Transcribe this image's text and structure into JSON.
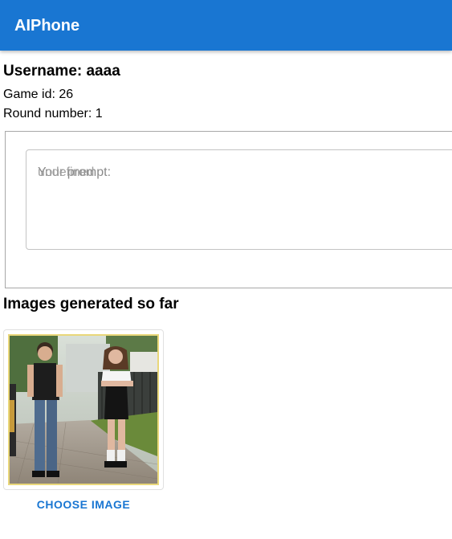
{
  "appbar": {
    "title": "AIPhone"
  },
  "player": {
    "username_line": "Username: aaaa",
    "game_id_line": "Game id: 26",
    "round_line": "Round number: 1"
  },
  "prompt": {
    "label": "Your prompt:",
    "placeholder": "undefined"
  },
  "gallery": {
    "title": "Images generated so far",
    "choose_label": "CHOOSE IMAGE"
  }
}
